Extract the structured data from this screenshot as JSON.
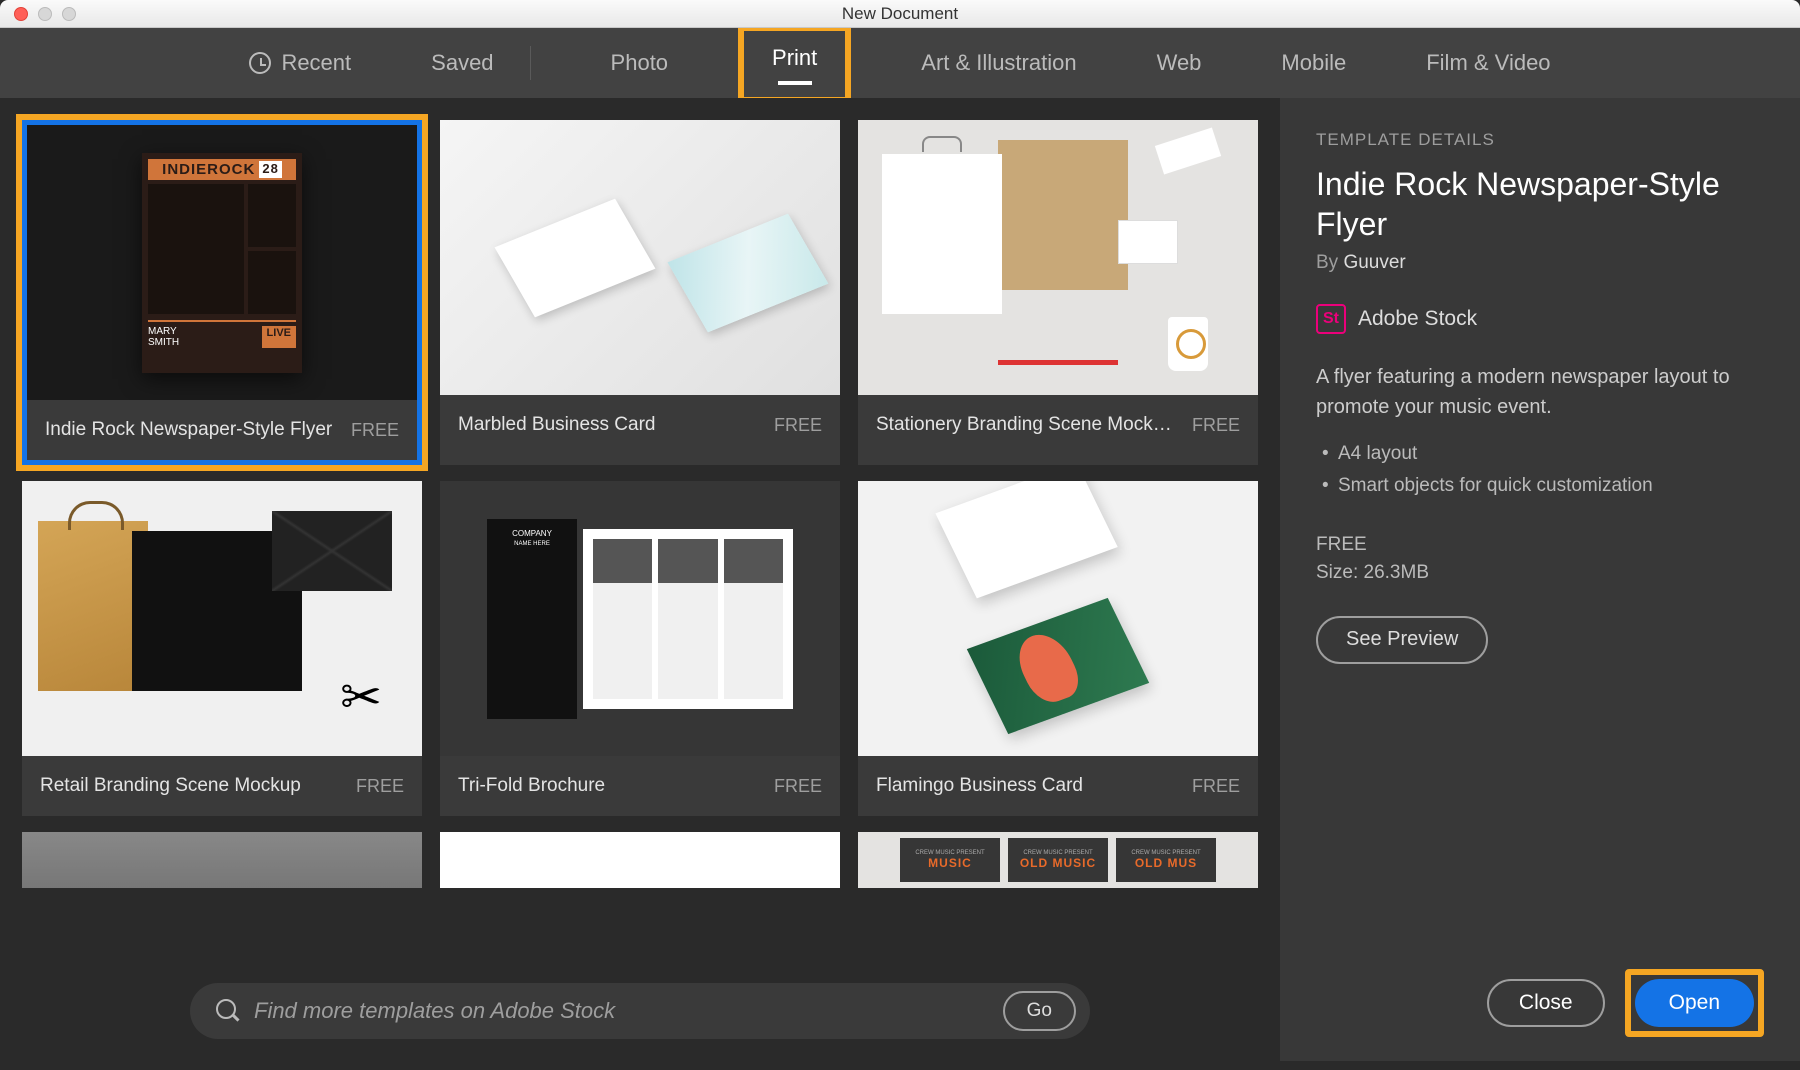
{
  "window": {
    "title": "New Document"
  },
  "tabs": {
    "recent": "Recent",
    "saved": "Saved",
    "photo": "Photo",
    "print": "Print",
    "art": "Art & Illustration",
    "web": "Web",
    "mobile": "Mobile",
    "film": "Film & Video"
  },
  "templates": [
    {
      "name": "Indie Rock Newspaper-Style Flyer",
      "price": "FREE",
      "selected": true
    },
    {
      "name": "Marbled Business Card",
      "price": "FREE"
    },
    {
      "name": "Stationery Branding Scene Mock…",
      "price": "FREE"
    },
    {
      "name": "Retail Branding Scene Mockup",
      "price": "FREE"
    },
    {
      "name": "Tri-Fold Brochure",
      "price": "FREE"
    },
    {
      "name": "Flamingo Business Card",
      "price": "FREE"
    }
  ],
  "peek_music": {
    "line0": "CREW MUSIC PRESENT",
    "line1_a": "MUSIC",
    "line1_b": "OLD MUSIC",
    "line1_c": "OLD MUS"
  },
  "search": {
    "placeholder": "Find more templates on Adobe Stock",
    "go": "Go"
  },
  "details": {
    "heading": "TEMPLATE DETAILS",
    "name": "Indie Rock Newspaper-Style Flyer",
    "by": "By ",
    "author": "Guuver",
    "stock_badge": "St",
    "stock_label": "Adobe Stock",
    "description": "A flyer featuring a modern newspaper layout to promote your music event.",
    "bullets": [
      "A4 layout",
      "Smart objects for quick customization"
    ],
    "price": "FREE",
    "size": "Size: 26.3MB",
    "see_preview": "See Preview",
    "close": "Close",
    "open": "Open"
  },
  "flyer_art": {
    "brand": "INDIEROCK",
    "num": "28",
    "name1": "MARY",
    "name2": "SMITH",
    "live": "LIVE"
  }
}
